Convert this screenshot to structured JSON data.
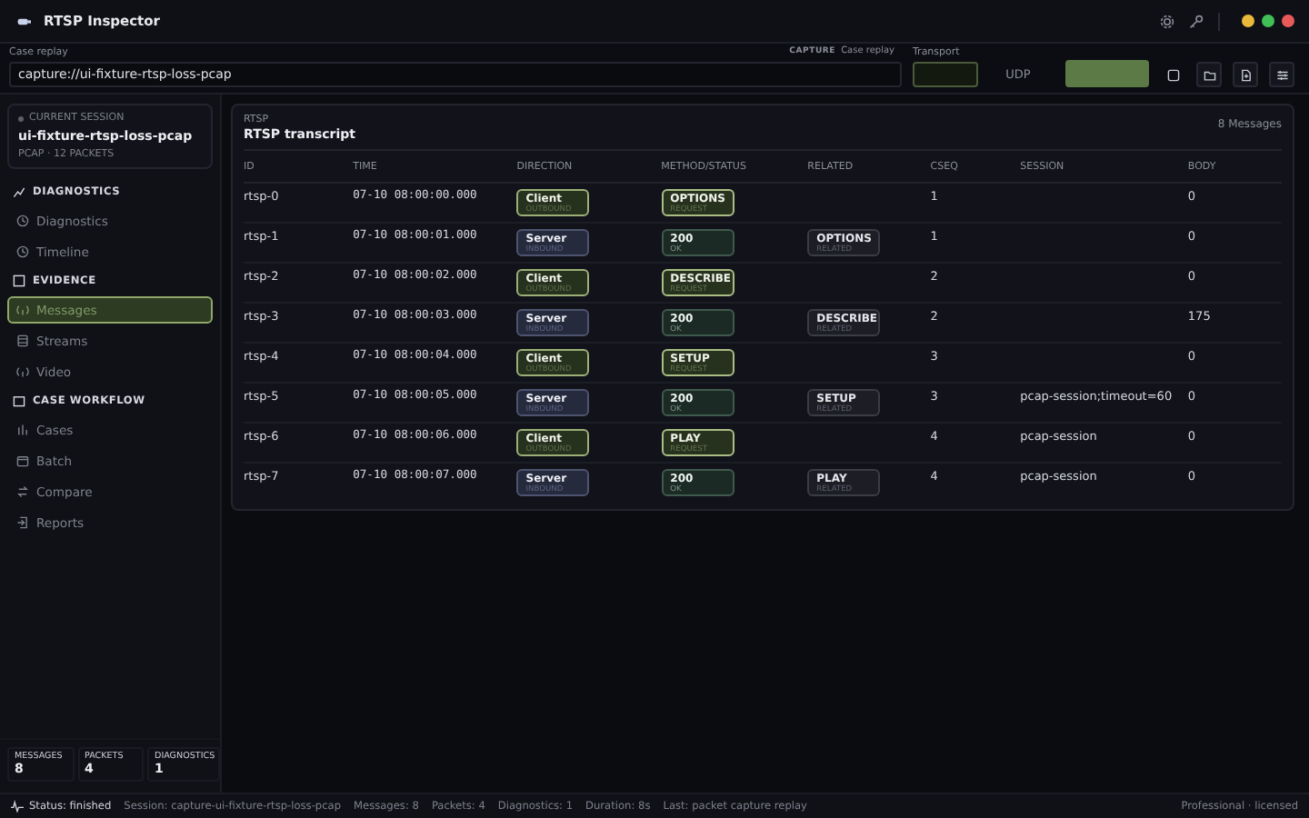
{
  "window": {
    "title": "RTSP Inspector"
  },
  "replay": {
    "label": "Case replay",
    "value": "capture://ui-fixture-rtsp-loss-pcap",
    "capture_tag": "CAPTURE",
    "capture_value": "Case replay",
    "transport_label": "Transport",
    "transport_option": "UDP"
  },
  "session": {
    "eyebrow": "CURRENT SESSION",
    "name": "ui-fixture-rtsp-loss-pcap",
    "meta": "PCAP · 12 PACKETS"
  },
  "sidebar": {
    "sections": [
      {
        "title": "DIAGNOSTICS",
        "items": [
          {
            "label": "Diagnostics",
            "selected": false
          },
          {
            "label": "Timeline",
            "selected": false
          }
        ]
      },
      {
        "title": "EVIDENCE",
        "items": [
          {
            "label": "Messages",
            "selected": true
          },
          {
            "label": "Streams",
            "selected": false
          },
          {
            "label": "Video",
            "selected": false
          }
        ]
      },
      {
        "title": "CASE WORKFLOW",
        "items": [
          {
            "label": "Cases",
            "selected": false
          },
          {
            "label": "Batch",
            "selected": false
          },
          {
            "label": "Compare",
            "selected": false
          },
          {
            "label": "Reports",
            "selected": false
          }
        ]
      }
    ]
  },
  "stats": [
    {
      "label": "MESSAGES",
      "value": "8"
    },
    {
      "label": "PACKETS",
      "value": "4"
    },
    {
      "label": "DIAGNOSTICS",
      "value": "1"
    }
  ],
  "panel": {
    "eyebrow": "RTSP",
    "title": "RTSP transcript",
    "count": "8 Messages"
  },
  "table": {
    "columns": [
      "ID",
      "TIME",
      "DIRECTION",
      "METHOD/STATUS",
      "RELATED",
      "CSEQ",
      "SESSION",
      "BODY"
    ],
    "rows": [
      {
        "id": "rtsp-0",
        "time": "07-10 08:00:00.000",
        "direction": {
          "kind": "client",
          "label": "Client",
          "sub": "OUTBOUND"
        },
        "method": {
          "kind": "request",
          "label": "OPTIONS",
          "sub": "REQUEST"
        },
        "cseq": "1",
        "body": "0"
      },
      {
        "id": "rtsp-1",
        "time": "07-10 08:00:01.000",
        "direction": {
          "kind": "server",
          "label": "Server",
          "sub": "INBOUND"
        },
        "method": {
          "kind": "response",
          "label": "200",
          "sub": "OK"
        },
        "related": {
          "label": "OPTIONS",
          "sub": "RELATED"
        },
        "cseq": "1",
        "body": "0"
      },
      {
        "id": "rtsp-2",
        "time": "07-10 08:00:02.000",
        "direction": {
          "kind": "client",
          "label": "Client",
          "sub": "OUTBOUND"
        },
        "method": {
          "kind": "request",
          "label": "DESCRIBE",
          "sub": "REQUEST"
        },
        "cseq": "2",
        "body": "0"
      },
      {
        "id": "rtsp-3",
        "time": "07-10 08:00:03.000",
        "direction": {
          "kind": "server",
          "label": "Server",
          "sub": "INBOUND"
        },
        "method": {
          "kind": "response",
          "label": "200",
          "sub": "OK"
        },
        "related": {
          "label": "DESCRIBE",
          "sub": "RELATED"
        },
        "cseq": "2",
        "body": "175"
      },
      {
        "id": "rtsp-4",
        "time": "07-10 08:00:04.000",
        "direction": {
          "kind": "client",
          "label": "Client",
          "sub": "OUTBOUND"
        },
        "method": {
          "kind": "request",
          "label": "SETUP",
          "sub": "REQUEST"
        },
        "cseq": "3",
        "body": "0"
      },
      {
        "id": "rtsp-5",
        "time": "07-10 08:00:05.000",
        "direction": {
          "kind": "server",
          "label": "Server",
          "sub": "INBOUND"
        },
        "method": {
          "kind": "response",
          "label": "200",
          "sub": "OK"
        },
        "related": {
          "label": "SETUP",
          "sub": "RELATED"
        },
        "cseq": "3",
        "session": "pcap-session;timeout=60",
        "body": "0"
      },
      {
        "id": "rtsp-6",
        "time": "07-10 08:00:06.000",
        "direction": {
          "kind": "client",
          "label": "Client",
          "sub": "OUTBOUND"
        },
        "method": {
          "kind": "request",
          "label": "PLAY",
          "sub": "REQUEST"
        },
        "cseq": "4",
        "session": "pcap-session",
        "body": "0"
      },
      {
        "id": "rtsp-7",
        "time": "07-10 08:00:07.000",
        "direction": {
          "kind": "server",
          "label": "Server",
          "sub": "INBOUND"
        },
        "method": {
          "kind": "response",
          "label": "200",
          "sub": "OK"
        },
        "related": {
          "label": "PLAY",
          "sub": "RELATED"
        },
        "cseq": "4",
        "session": "pcap-session",
        "body": "0"
      }
    ]
  },
  "status_bar": {
    "items": [
      "Status: finished",
      "Session: capture-ui-fixture-rtsp-loss-pcap",
      "Messages: 8",
      "Packets: 4",
      "Diagnostics: 1",
      "Duration: 8s",
      "Last: packet capture replay"
    ],
    "right": "Professional · licensed"
  }
}
